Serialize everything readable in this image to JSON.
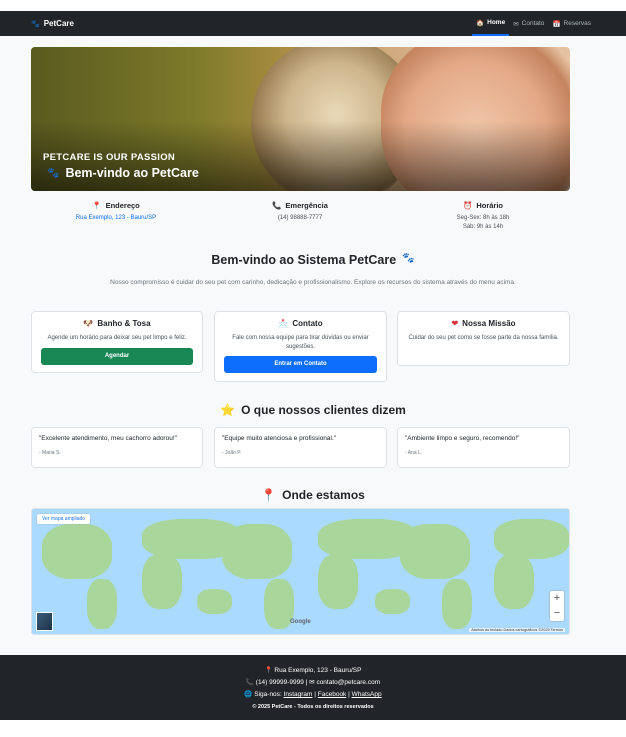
{
  "navbar": {
    "brand": "PetCare",
    "items": [
      {
        "label": "Home",
        "icon": "house-icon"
      },
      {
        "label": "Contato",
        "icon": "envelope-icon"
      },
      {
        "label": "Reservas",
        "icon": "calendar-icon"
      }
    ]
  },
  "hero": {
    "tagline": "PETCARE IS OUR PASSION",
    "title": "Bem-vindo ao PetCare"
  },
  "info": {
    "address": {
      "title": "Endereço",
      "value": "Rua Exemplo, 123 - Bauru/SP"
    },
    "emergency": {
      "title": "Emergência",
      "value": "(14) 98888-7777"
    },
    "hours": {
      "title": "Horário",
      "line1": "Seg-Sex: 8h às 18h",
      "line2": "Sáb: 9h às 14h"
    }
  },
  "welcome": {
    "title": "Bem-vindo ao Sistema PetCare",
    "text": "Nosso compromisso é cuidar do seu pet com carinho, dedicação e profissionalismo. Explore os recursos do sistema através do menu acima."
  },
  "cards": [
    {
      "title": "Banho & Tosa",
      "text": "Agende um horário para deixar seu pet limpo e feliz.",
      "button": "Agendar"
    },
    {
      "title": "Contato",
      "text": "Fale com nossa equipe para tirar dúvidas ou enviar sugestões.",
      "button": "Entrar em Contato"
    },
    {
      "title": "Nossa Missão",
      "text": "Cuidar do seu pet como se fosse parte da nossa família."
    }
  ],
  "testimonials": {
    "title": "O que nossos clientes dizem",
    "items": [
      {
        "quote": "\"Excelente atendimento, meu cachorro adorou!\"",
        "author": "- Maria S."
      },
      {
        "quote": "\"Equipe muito atenciosa e profissional.\"",
        "author": "- João P."
      },
      {
        "quote": "\"Ambiente limpo e seguro, recomendo!\"",
        "author": "- Ana L."
      }
    ]
  },
  "map": {
    "title": "Onde estamos",
    "enlarge": "Ver mapa ampliado",
    "zoom_in": "+",
    "zoom_out": "−",
    "logo": "Google",
    "attribution": "Atalhos do teclado   Dados cartográficos ©2025   Termos"
  },
  "footer": {
    "address": "Rua Exemplo, 123 - Bauru/SP",
    "phone": "(14) 99999-9999",
    "email": "contato@petcare.com",
    "follow": "Siga-nos:",
    "links": [
      "Instagram",
      "Facebook",
      "WhatsApp"
    ],
    "copyright": "© 2025 PetCare - Todos os direitos reservados"
  },
  "colors": {
    "primary": "#0d6efd",
    "success": "#198754",
    "dark": "#212529"
  }
}
